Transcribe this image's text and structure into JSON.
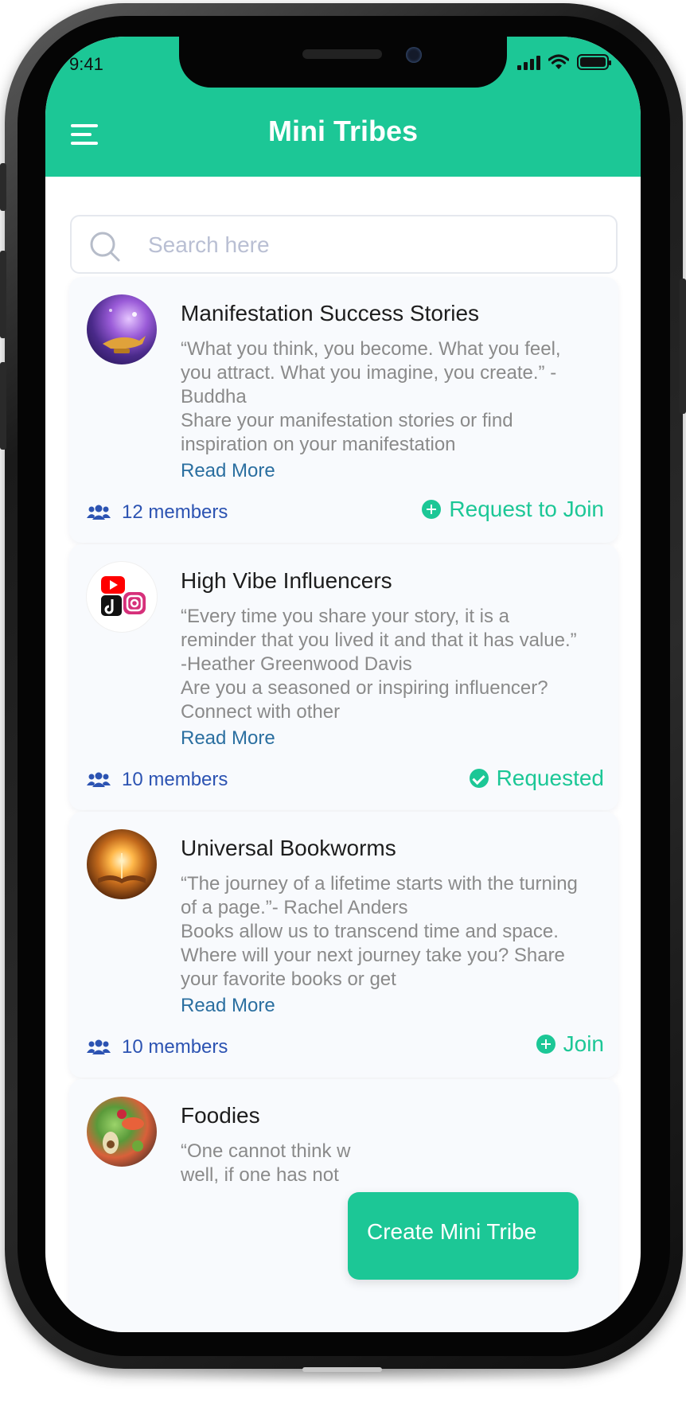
{
  "status_bar": {
    "time": "9:41"
  },
  "header": {
    "title": "Mini Tribes"
  },
  "search": {
    "placeholder": "Search here"
  },
  "tribes": [
    {
      "title": "Manifestation Success Stories",
      "description": "“What you think, you become. What you feel, you attract. What you imagine, you create.” -Buddha\nShare your manifestation stories or find inspiration on your manifestation",
      "read_more": "Read More",
      "members": "12 members",
      "action": "Request to Join",
      "action_state": "request",
      "avatar": "magic-lamp-image"
    },
    {
      "title": "High Vibe Influencers",
      "description": "“Every time you share your story, it is a reminder that you lived it and that it has value.” -Heather Greenwood Davis\nAre you a seasoned or inspiring influencer? Connect with other",
      "read_more": "Read More",
      "members": "10 members",
      "action": "Requested",
      "action_state": "requested",
      "avatar": "social-media-logos-image"
    },
    {
      "title": "Universal Bookworms",
      "description": "“The journey of a lifetime starts with the turning of a page.”- Rachel Anders\nBooks allow us to transcend time and space. Where will your next journey take you? Share your favorite books or get",
      "read_more": "Read More",
      "members": "10 members",
      "action": "Join",
      "action_state": "join",
      "avatar": "glowing-book-image"
    },
    {
      "title": "Foodies",
      "description": "“One cannot think w\nwell, if one has not",
      "avatar": "healthy-food-image"
    }
  ],
  "create_button": {
    "label": "Create Mini Tribe"
  },
  "colors": {
    "accent": "#1cc796",
    "members_text": "#2c53b2",
    "link": "#2b6fa0"
  }
}
